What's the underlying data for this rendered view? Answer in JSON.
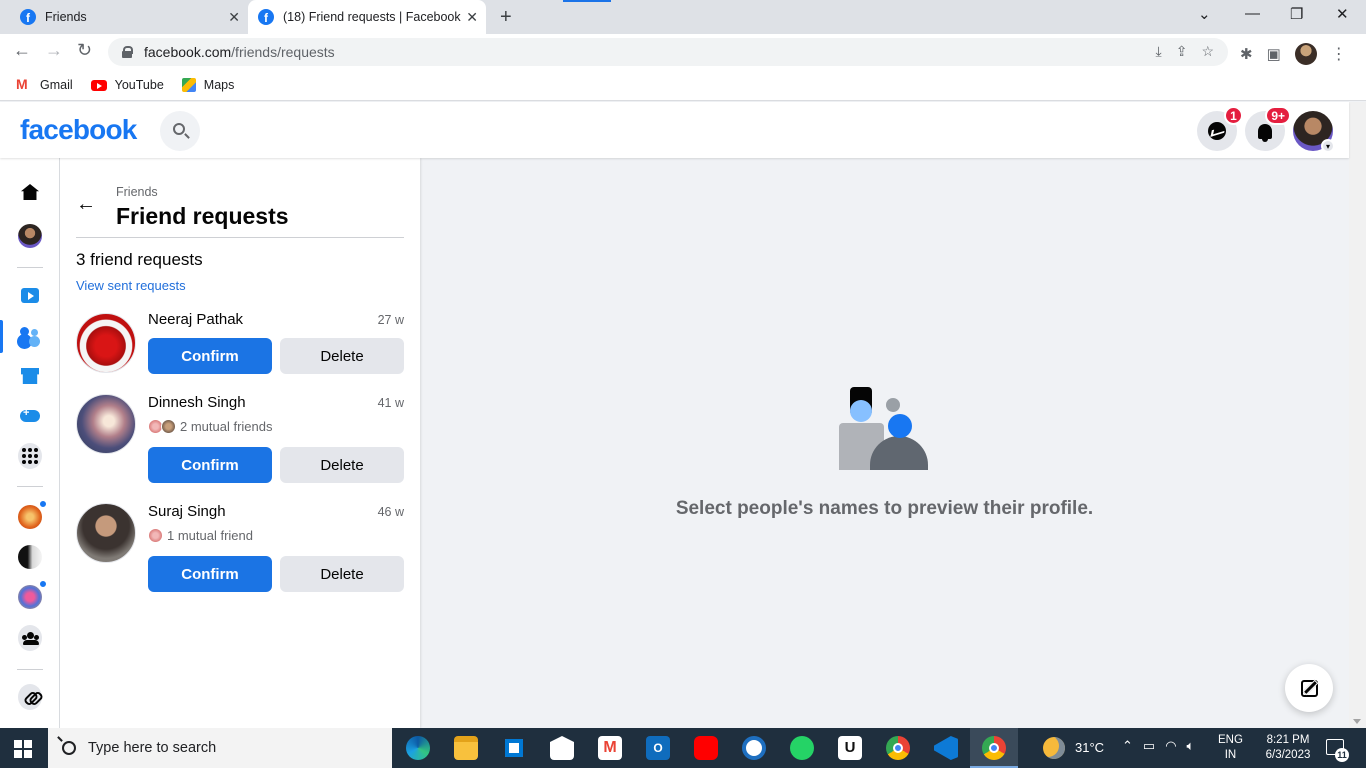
{
  "browser": {
    "tabs": [
      {
        "title": "Friends"
      },
      {
        "title": "(18) Friend requests | Facebook"
      }
    ],
    "url_host": "facebook.com",
    "url_path": "/friends/requests",
    "bookmarks": [
      {
        "label": "Gmail",
        "icon": "gmail-icon"
      },
      {
        "label": "YouTube",
        "icon": "youtube-icon"
      },
      {
        "label": "Maps",
        "icon": "maps-icon"
      }
    ]
  },
  "header": {
    "logo": "facebook",
    "messenger_badge": "1",
    "notifications_badge": "9+",
    "brand_color": "#1877f2"
  },
  "panel": {
    "breadcrumb": "Friends",
    "title": "Friend requests",
    "count_label": "3 friend requests",
    "sent_link": "View sent requests",
    "requests": [
      {
        "name": "Neeraj Pathak",
        "time": "27 w",
        "mutual": "",
        "confirm": "Confirm",
        "delete": "Delete"
      },
      {
        "name": "Dinnesh Singh",
        "time": "41 w",
        "mutual": "2 mutual friends",
        "confirm": "Confirm",
        "delete": "Delete"
      },
      {
        "name": "Suraj Singh",
        "time": "46 w",
        "mutual": "1 mutual friend",
        "confirm": "Confirm",
        "delete": "Delete"
      }
    ]
  },
  "main": {
    "empty_text": "Select people's names to preview their profile."
  },
  "taskbar": {
    "search_placeholder": "Type here to search",
    "temperature": "31°C",
    "lang_line1": "ENG",
    "lang_line2": "IN",
    "time": "8:21 PM",
    "date": "6/3/2023",
    "notification_count": "11",
    "pinned_apps": [
      "Edge",
      "File Explorer",
      "Microsoft Store",
      "Mail",
      "Gmail",
      "Outlook",
      "YouTube",
      "WordPress",
      "WhatsApp",
      "Unacademy",
      "Chrome",
      "Visual Studio Code",
      "Chrome"
    ]
  }
}
